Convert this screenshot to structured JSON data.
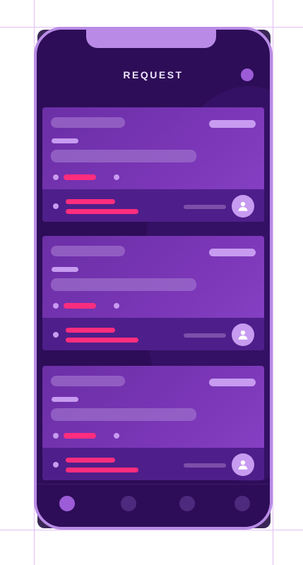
{
  "header": {
    "title": "REQUEST"
  },
  "cards": [
    {
      "id": 1
    },
    {
      "id": 2
    },
    {
      "id": 3
    }
  ],
  "navigation": {
    "items": [
      {
        "icon": "nav-dot-icon",
        "active": true
      },
      {
        "icon": "nav-dot-icon",
        "active": false
      },
      {
        "icon": "nav-dot-icon",
        "active": false
      },
      {
        "icon": "nav-dot-icon",
        "active": false
      }
    ]
  },
  "colors": {
    "accent": "#9c5cd7",
    "highlight": "#ff2d7d",
    "frame": "#b98be6",
    "background": "#2d0d57"
  }
}
